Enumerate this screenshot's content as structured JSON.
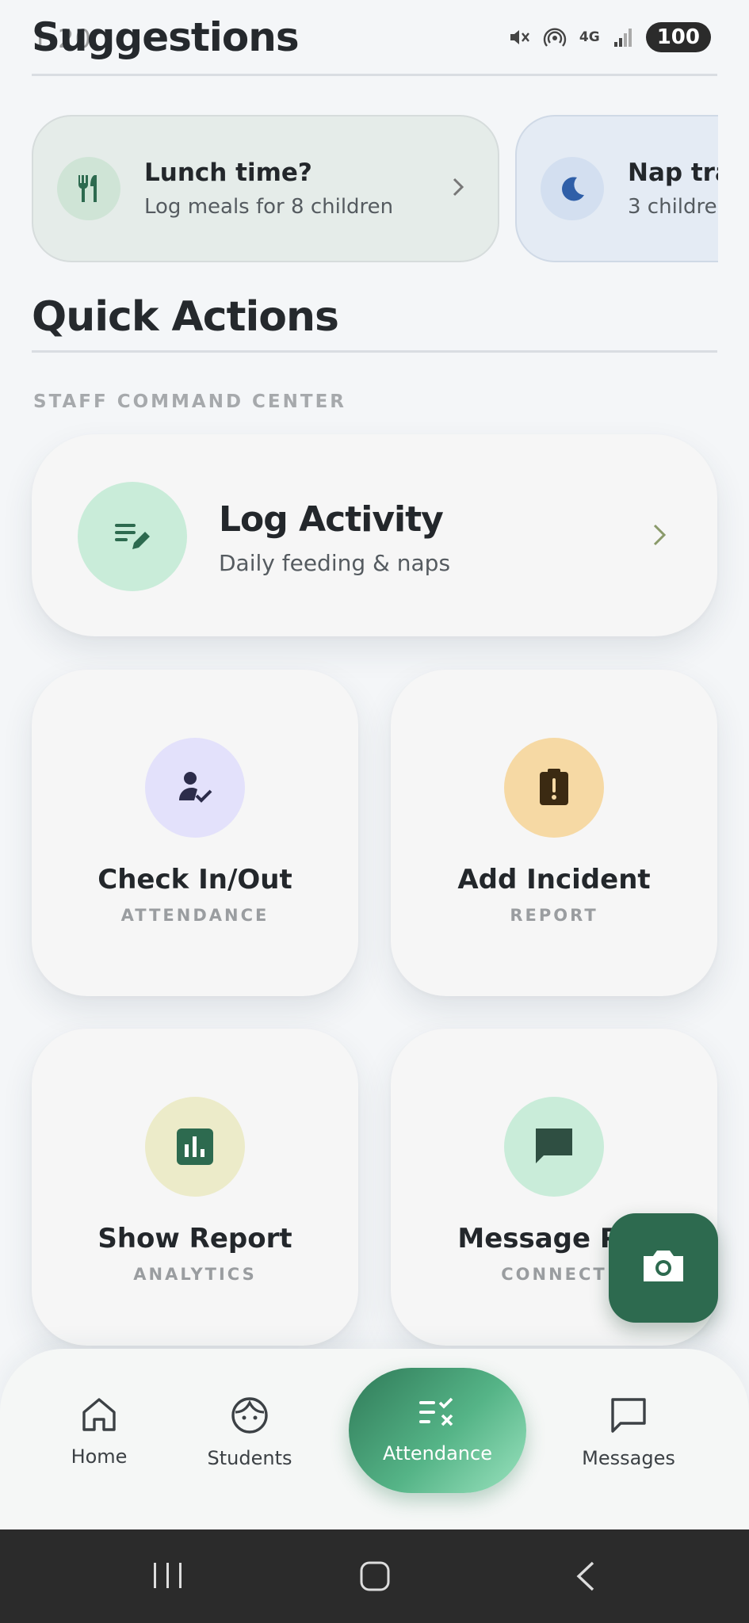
{
  "status_bar": {
    "time": "1:20",
    "battery": "100",
    "network": "4G"
  },
  "suggestions": {
    "title": "Suggestions",
    "cards": [
      {
        "title": "Lunch time?",
        "subtitle": "Log meals for 8 children",
        "icon": "utensils-icon"
      },
      {
        "title": "Nap tra",
        "subtitle": "3 childre",
        "icon": "moon-icon"
      }
    ]
  },
  "quick_actions": {
    "title": "Quick Actions",
    "section_label": "STAFF COMMAND CENTER",
    "log_activity": {
      "title": "Log Activity",
      "subtitle": "Daily feeding & naps",
      "icon": "notes-pencil-icon"
    },
    "tiles": [
      {
        "title": "Check In/Out",
        "subtitle": "ATTENDANCE",
        "icon": "person-check-icon",
        "color": "#e3e1fb"
      },
      {
        "title": "Add Incident",
        "subtitle": "REPORT",
        "icon": "clipboard-alert-icon",
        "color": "#f6d9a4"
      },
      {
        "title": "Show Report",
        "subtitle": "ANALYTICS",
        "icon": "bar-chart-icon",
        "color": "#ecebc9"
      },
      {
        "title": "Message Par",
        "subtitle": "CONNECT",
        "icon": "chat-icon",
        "color": "#c9ecd9"
      }
    ]
  },
  "fab": {
    "icon": "camera-icon"
  },
  "bottom_nav": {
    "items": [
      {
        "label": "Home",
        "icon": "home-icon"
      },
      {
        "label": "Students",
        "icon": "student-face-icon"
      },
      {
        "label": "Attendance",
        "icon": "checklist-icon",
        "active": true
      },
      {
        "label": "Messages",
        "icon": "message-square-icon"
      }
    ]
  },
  "colors": {
    "primary": "#2d6a4f",
    "background": "#f4f6f8",
    "text": "#23272b"
  }
}
